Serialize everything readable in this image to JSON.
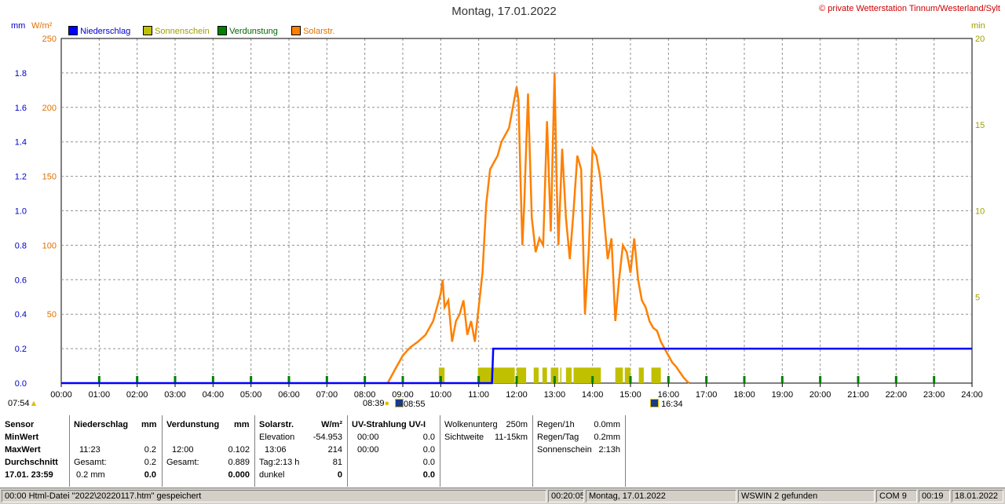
{
  "title": "Montag, 17.01.2022",
  "copyright": "© private Wetterstation Tinnum/Westerland/Sylt",
  "units": {
    "left1": "mm",
    "left2": "W/m²",
    "right": "min"
  },
  "legend": [
    {
      "label": "Niederschlag",
      "color": "#0000ff"
    },
    {
      "label": "Sonnenschein",
      "color": "#c0c000"
    },
    {
      "label": "Verdunstung",
      "color": "#008000"
    },
    {
      "label": "Solarstr.",
      "color": "#ff8000"
    }
  ],
  "sun_markers": {
    "sunrise": "07:54",
    "sunset": "16:34",
    "sunshine_start": "08:39",
    "solar_start": "08:55"
  },
  "chart_data": {
    "type": "line",
    "x_ticks": [
      "00:00",
      "01:00",
      "02:00",
      "03:00",
      "04:00",
      "05:00",
      "06:00",
      "07:00",
      "08:00",
      "09:00",
      "10:00",
      "11:00",
      "12:00",
      "13:00",
      "14:00",
      "15:00",
      "16:00",
      "17:00",
      "18:00",
      "19:00",
      "20:00",
      "21:00",
      "22:00",
      "23:00",
      "24:00"
    ],
    "y_left_mm": {
      "ticks": [
        "0.0",
        "0.2",
        "0.4",
        "0.6",
        "0.8",
        "1.0",
        "1.2",
        "1.4",
        "1.6",
        "1.8"
      ],
      "lim": [
        0,
        2.0
      ]
    },
    "y_left_wm2": {
      "ticks": [
        "50",
        "100",
        "150",
        "200",
        "250"
      ],
      "lim": [
        0,
        250
      ]
    },
    "y_right_min": {
      "ticks": [
        "5",
        "10",
        "15",
        "20"
      ],
      "lim": [
        0,
        20
      ]
    },
    "series": [
      {
        "name": "Solarstr.",
        "axis": "W/m²",
        "color": "#ff8000",
        "x": [
          8.6,
          8.8,
          9.0,
          9.2,
          9.4,
          9.6,
          9.8,
          9.9,
          10.0,
          10.05,
          10.1,
          10.2,
          10.3,
          10.4,
          10.5,
          10.6,
          10.7,
          10.8,
          10.9,
          11.0,
          11.1,
          11.2,
          11.3,
          11.4,
          11.5,
          11.6,
          11.7,
          11.8,
          11.9,
          12.0,
          12.05,
          12.1,
          12.15,
          12.2,
          12.3,
          12.4,
          12.5,
          12.6,
          12.7,
          12.8,
          12.9,
          13.0,
          13.05,
          13.1,
          13.2,
          13.3,
          13.4,
          13.5,
          13.6,
          13.7,
          13.8,
          13.9,
          14.0,
          14.1,
          14.2,
          14.3,
          14.4,
          14.5,
          14.6,
          14.7,
          14.8,
          14.9,
          15.0,
          15.1,
          15.2,
          15.3,
          15.4,
          15.5,
          15.6,
          15.7,
          15.8,
          15.9,
          16.0,
          16.1,
          16.2,
          16.3,
          16.4,
          16.5,
          16.55
        ],
        "y": [
          0,
          10,
          20,
          26,
          30,
          35,
          45,
          55,
          65,
          75,
          55,
          60,
          30,
          45,
          50,
          60,
          35,
          45,
          30,
          55,
          80,
          130,
          155,
          160,
          165,
          175,
          180,
          185,
          200,
          215,
          205,
          150,
          100,
          130,
          210,
          120,
          95,
          105,
          100,
          190,
          110,
          225,
          150,
          100,
          170,
          120,
          90,
          125,
          165,
          155,
          50,
          95,
          170,
          165,
          150,
          120,
          90,
          105,
          45,
          75,
          100,
          95,
          80,
          105,
          75,
          60,
          55,
          45,
          40,
          38,
          30,
          25,
          20,
          15,
          12,
          8,
          4,
          1,
          0
        ]
      },
      {
        "name": "Niederschlag",
        "axis": "mm",
        "color": "#0000ff",
        "x": [
          0,
          11.35,
          11.383,
          24
        ],
        "y": [
          0,
          0,
          0.2,
          0.2
        ]
      },
      {
        "name": "Sonnenschein",
        "axis": "min",
        "color": "#c0c000",
        "intervals": [
          [
            9.95,
            10.1
          ],
          [
            10.98,
            11.95
          ],
          [
            12.0,
            12.25
          ],
          [
            12.45,
            12.58
          ],
          [
            12.68,
            12.8
          ],
          [
            12.9,
            13.1
          ],
          [
            13.15,
            13.18
          ],
          [
            13.3,
            13.45
          ],
          [
            13.5,
            14.22
          ],
          [
            14.6,
            14.8
          ],
          [
            14.85,
            15.0
          ],
          [
            15.22,
            15.35
          ],
          [
            15.55,
            15.8
          ]
        ],
        "value": 0.9
      },
      {
        "name": "Verdunstung",
        "axis": "mm",
        "color": "#008000",
        "x": [
          1,
          2,
          3,
          4,
          5,
          6,
          7,
          8,
          9,
          10,
          11,
          12,
          13,
          14,
          15,
          16,
          17,
          18,
          19,
          20,
          21,
          22,
          23
        ],
        "marks": true
      }
    ]
  },
  "table": {
    "col1": {
      "header": "Sensor",
      "rows": [
        "MinWert",
        "MaxWert",
        "Durchschnitt",
        "17.01. 23:59"
      ]
    },
    "niederschlag": {
      "header": "Niederschlag",
      "unit": "mm",
      "max_time": "11:23",
      "max_val": "0.2",
      "gesamt_label": "Gesamt:",
      "gesamt_val": "0.2",
      "avg": "0.2 mm",
      "last": "0.0"
    },
    "verdunstung": {
      "header": "Verdunstung",
      "unit": "mm",
      "max_time": "12:00",
      "max_val": "0.102",
      "gesamt_label": "Gesamt:",
      "gesamt_val": "0.889",
      "last": "0.000"
    },
    "solar": {
      "header": "Solarstr.",
      "unit": "W/m²",
      "elev_label": "Elevation",
      "elev_val": "-54.953",
      "max_time": "13:06",
      "max_val": "214",
      "tag_label": "Tag:2:13 h",
      "tag_val": "81",
      "dunkel_label": "dunkel",
      "dunkel_val": "0"
    },
    "uv": {
      "header": "UV-Strahlung UV-I",
      "min_time": "00:00",
      "min_val": "0.0",
      "max_time": "00:00",
      "max_val": "0.0",
      "avg_val": "0.0",
      "last": "0.0"
    },
    "wolken": {
      "l1": "Wolkenunterg",
      "v1": "250m",
      "l2": "Sichtweite",
      "v2": "11-15km"
    },
    "regen": {
      "l1": "Regen/1h",
      "v1": "0.0mm",
      "l2": "Regen/Tag",
      "v2": "0.2mm",
      "l3": "Sonnenschein",
      "v3": "2:13h"
    }
  },
  "status": {
    "c1": "00:00  Html-Datei  \"2022\\20220117.htm\"  gespeichert",
    "c2": "00:20:05",
    "c3": "Montag, 17.01.2022",
    "c4": "WSWIN 2 gefunden",
    "c5": "COM 9",
    "c6": "00:19",
    "c7": "18.01.2022"
  }
}
